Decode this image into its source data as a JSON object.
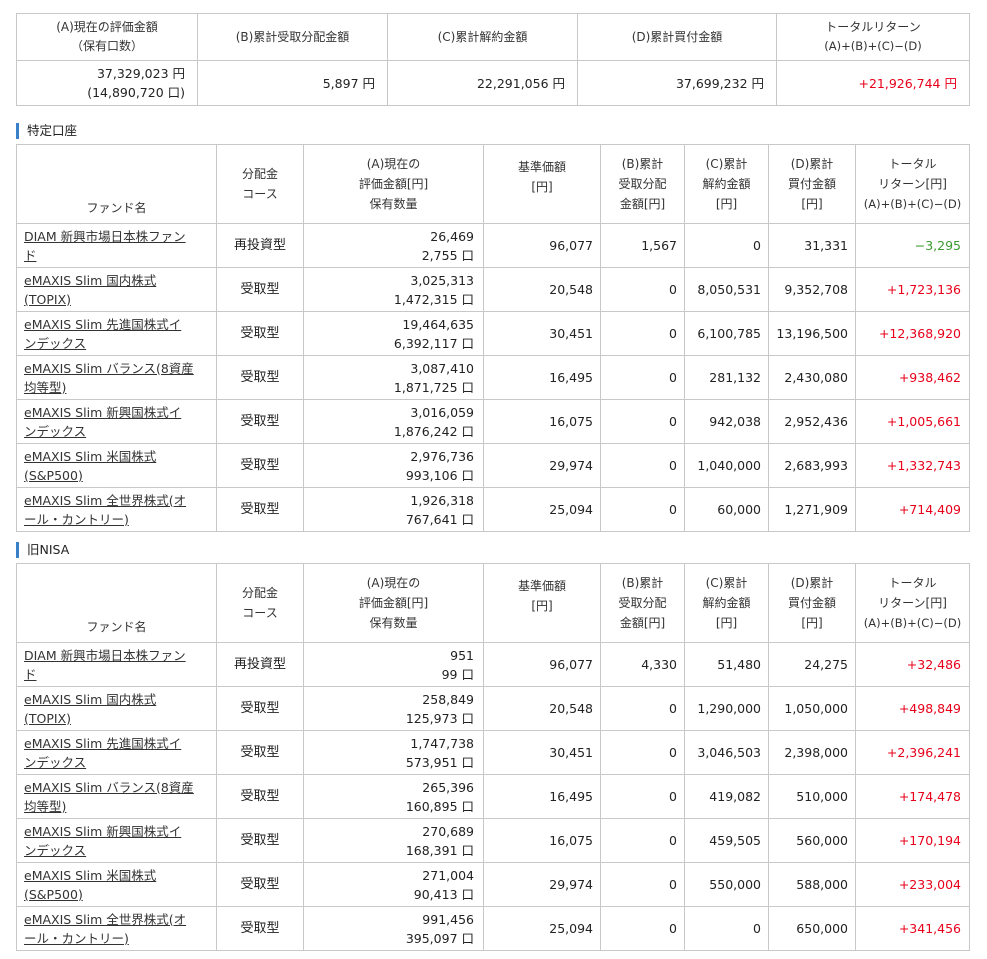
{
  "summary": {
    "headers": {
      "a_line1": "(A)現在の評価金額",
      "a_line2": "（保有口数）",
      "b": "(B)累計受取分配金額",
      "c": "(C)累計解約金額",
      "d": "(D)累計買付金額",
      "total_line1": "トータルリターン",
      "total_line2": "(A)+(B)+(C)−(D)"
    },
    "values": {
      "a_amount": "37,329,023 円",
      "a_units": "(14,890,720 口)",
      "b": "5,897 円",
      "c": "22,291,056 円",
      "d": "37,699,232 円",
      "total": "+21,926,744 円"
    }
  },
  "tokutei": {
    "title": "特定口座",
    "headers": {
      "name": "ファンド名",
      "course_l1": "分配金",
      "course_l2": "コース",
      "a_l1": "(A)現在の",
      "a_l2": "評価金額[円]",
      "a_l3": "保有数量",
      "nav_l1": "基準価額",
      "nav_l2": "[円]",
      "b_l1": "(B)累計",
      "b_l2": "受取分配",
      "b_l3": "金額[円]",
      "c_l1": "(C)累計",
      "c_l2": "解約金額",
      "c_l3": "[円]",
      "d_l1": "(D)累計",
      "d_l2": "買付金額",
      "d_l3": "[円]",
      "r_l1": "トータル",
      "r_l2": "リターン[円]",
      "r_l3": "(A)+(B)+(C)−(D)"
    },
    "rows": [
      {
        "name_l1": "DIAM 新興市場日本株ファン",
        "name_l2": "ド",
        "course": "再投資型",
        "a": "26,469",
        "units": "2,755 口",
        "nav": "96,077",
        "b": "1,567",
        "c": "0",
        "d": "31,331",
        "ret": "−3,295"
      },
      {
        "name_l1": "eMAXIS Slim 国内株式",
        "name_l2": "(TOPIX)",
        "course": "受取型",
        "a": "3,025,313",
        "units": "1,472,315 口",
        "nav": "20,548",
        "b": "0",
        "c": "8,050,531",
        "d": "9,352,708",
        "ret": "+1,723,136"
      },
      {
        "name_l1": "eMAXIS Slim 先進国株式イ",
        "name_l2": "ンデックス",
        "course": "受取型",
        "a": "19,464,635",
        "units": "6,392,117 口",
        "nav": "30,451",
        "b": "0",
        "c": "6,100,785",
        "d": "13,196,500",
        "ret": "+12,368,920"
      },
      {
        "name_l1": "eMAXIS Slim バランス(8資産",
        "name_l2": "均等型)",
        "course": "受取型",
        "a": "3,087,410",
        "units": "1,871,725 口",
        "nav": "16,495",
        "b": "0",
        "c": "281,132",
        "d": "2,430,080",
        "ret": "+938,462"
      },
      {
        "name_l1": "eMAXIS Slim 新興国株式イ",
        "name_l2": "ンデックス",
        "course": "受取型",
        "a": "3,016,059",
        "units": "1,876,242 口",
        "nav": "16,075",
        "b": "0",
        "c": "942,038",
        "d": "2,952,436",
        "ret": "+1,005,661"
      },
      {
        "name_l1": "eMAXIS Slim 米国株式",
        "name_l2": "(S&P500)",
        "course": "受取型",
        "a": "2,976,736",
        "units": "993,106 口",
        "nav": "29,974",
        "b": "0",
        "c": "1,040,000",
        "d": "2,683,993",
        "ret": "+1,332,743"
      },
      {
        "name_l1": "eMAXIS Slim 全世界株式(オ",
        "name_l2": "ール・カントリー)",
        "course": "受取型",
        "a": "1,926,318",
        "units": "767,641 口",
        "nav": "25,094",
        "b": "0",
        "c": "60,000",
        "d": "1,271,909",
        "ret": "+714,409"
      }
    ]
  },
  "nisa": {
    "title": "旧NISA",
    "rows": [
      {
        "name_l1": "DIAM 新興市場日本株ファン",
        "name_l2": "ド",
        "course": "再投資型",
        "a": "951",
        "units": "99 口",
        "nav": "96,077",
        "b": "4,330",
        "c": "51,480",
        "d": "24,275",
        "ret": "+32,486"
      },
      {
        "name_l1": "eMAXIS Slim 国内株式",
        "name_l2": "(TOPIX)",
        "course": "受取型",
        "a": "258,849",
        "units": "125,973 口",
        "nav": "20,548",
        "b": "0",
        "c": "1,290,000",
        "d": "1,050,000",
        "ret": "+498,849"
      },
      {
        "name_l1": "eMAXIS Slim 先進国株式イ",
        "name_l2": "ンデックス",
        "course": "受取型",
        "a": "1,747,738",
        "units": "573,951 口",
        "nav": "30,451",
        "b": "0",
        "c": "3,046,503",
        "d": "2,398,000",
        "ret": "+2,396,241"
      },
      {
        "name_l1": "eMAXIS Slim バランス(8資産",
        "name_l2": "均等型)",
        "course": "受取型",
        "a": "265,396",
        "units": "160,895 口",
        "nav": "16,495",
        "b": "0",
        "c": "419,082",
        "d": "510,000",
        "ret": "+174,478"
      },
      {
        "name_l1": "eMAXIS Slim 新興国株式イ",
        "name_l2": "ンデックス",
        "course": "受取型",
        "a": "270,689",
        "units": "168,391 口",
        "nav": "16,075",
        "b": "0",
        "c": "459,505",
        "d": "560,000",
        "ret": "+170,194"
      },
      {
        "name_l1": "eMAXIS Slim 米国株式",
        "name_l2": "(S&P500)",
        "course": "受取型",
        "a": "271,004",
        "units": "90,413 口",
        "nav": "29,974",
        "b": "0",
        "c": "550,000",
        "d": "588,000",
        "ret": "+233,004"
      },
      {
        "name_l1": "eMAXIS Slim 全世界株式(オ",
        "name_l2": "ール・カントリー)",
        "course": "受取型",
        "a": "991,456",
        "units": "395,097 口",
        "nav": "25,094",
        "b": "0",
        "c": "0",
        "d": "650,000",
        "ret": "+341,456"
      }
    ]
  }
}
